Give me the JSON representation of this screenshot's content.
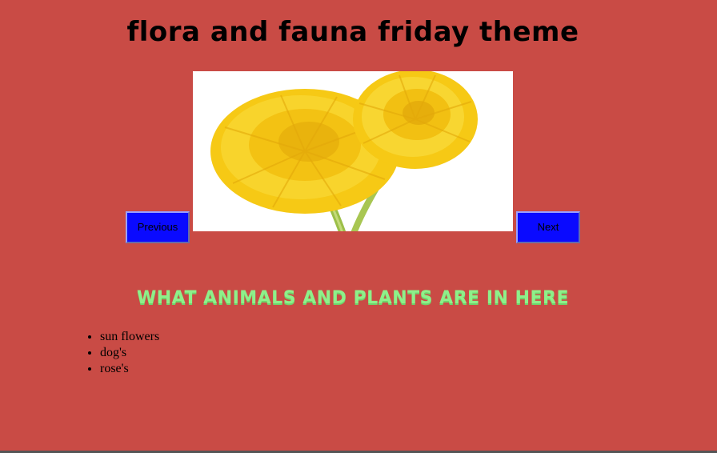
{
  "page": {
    "title": "flora and fauna friday theme",
    "section_heading": "WHAT ANIMALS AND PLANTS ARE IN HERE"
  },
  "slideshow": {
    "image_icon": "dandelion-flowers-image",
    "previous_label": "Previous",
    "next_label": "Next"
  },
  "list": {
    "items": [
      "sun flowers",
      "dog's",
      "rose's"
    ]
  },
  "colors": {
    "background": "#c94b45",
    "button": "#0a0aff",
    "heading": "#8ef08a"
  }
}
